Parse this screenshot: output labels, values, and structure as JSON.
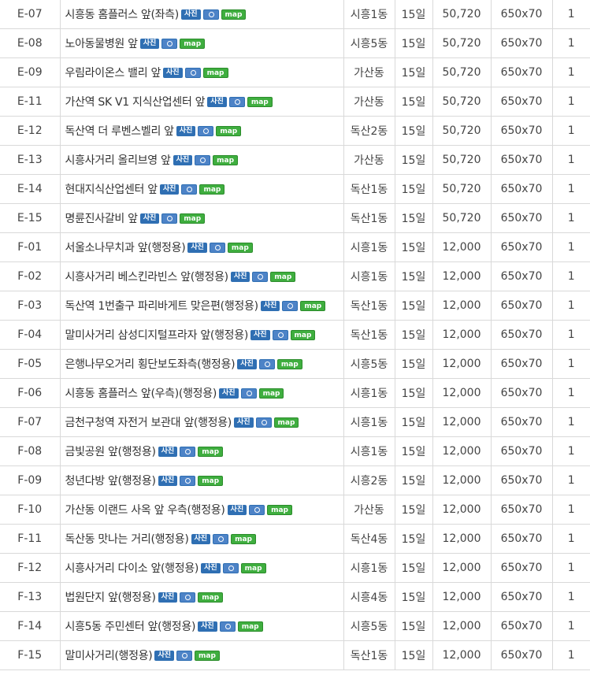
{
  "buttons": {
    "photo": "사진",
    "map": "map"
  },
  "rows": [
    {
      "code": "E-07",
      "name": "시흥동 홈플러스 앞(좌측)",
      "dong": "시흥1동",
      "period": "15일",
      "price": "50,720",
      "size": "650x70",
      "qty": "1"
    },
    {
      "code": "E-08",
      "name": "노아동물병원 앞",
      "dong": "시흥5동",
      "period": "15일",
      "price": "50,720",
      "size": "650x70",
      "qty": "1"
    },
    {
      "code": "E-09",
      "name": "우림라이온스 밸리 앞",
      "dong": "가산동",
      "period": "15일",
      "price": "50,720",
      "size": "650x70",
      "qty": "1"
    },
    {
      "code": "E-11",
      "name": "가산역 SK V1 지식산업센터 앞",
      "dong": "가산동",
      "period": "15일",
      "price": "50,720",
      "size": "650x70",
      "qty": "1"
    },
    {
      "code": "E-12",
      "name": "독산역 더 루벤스벨리 앞",
      "dong": "독산2동",
      "period": "15일",
      "price": "50,720",
      "size": "650x70",
      "qty": "1"
    },
    {
      "code": "E-13",
      "name": "시흥사거리 올리브영 앞",
      "dong": "가산동",
      "period": "15일",
      "price": "50,720",
      "size": "650x70",
      "qty": "1"
    },
    {
      "code": "E-14",
      "name": "현대지식산업센터 앞",
      "dong": "독산1동",
      "period": "15일",
      "price": "50,720",
      "size": "650x70",
      "qty": "1"
    },
    {
      "code": "E-15",
      "name": "명륜진사갈비 앞",
      "dong": "독산1동",
      "period": "15일",
      "price": "50,720",
      "size": "650x70",
      "qty": "1"
    },
    {
      "code": "F-01",
      "name": "서울소나무치과 앞(행정용)",
      "dong": "시흥1동",
      "period": "15일",
      "price": "12,000",
      "size": "650x70",
      "qty": "1"
    },
    {
      "code": "F-02",
      "name": "시흥사거리 베스킨라빈스 앞(행정용)",
      "dong": "시흥1동",
      "period": "15일",
      "price": "12,000",
      "size": "650x70",
      "qty": "1"
    },
    {
      "code": "F-03",
      "name": "독산역 1번출구 파리바게트 맞은편(행정용)",
      "dong": "독산1동",
      "period": "15일",
      "price": "12,000",
      "size": "650x70",
      "qty": "1"
    },
    {
      "code": "F-04",
      "name": "말미사거리 삼성디지털프라자 앞(행정용)",
      "dong": "독산1동",
      "period": "15일",
      "price": "12,000",
      "size": "650x70",
      "qty": "1"
    },
    {
      "code": "F-05",
      "name": "은행나무오거리 횡단보도좌측(행정용)",
      "dong": "시흥5동",
      "period": "15일",
      "price": "12,000",
      "size": "650x70",
      "qty": "1"
    },
    {
      "code": "F-06",
      "name": "시흥동 홈플러스 앞(우측)(행정용)",
      "dong": "시흥1동",
      "period": "15일",
      "price": "12,000",
      "size": "650x70",
      "qty": "1"
    },
    {
      "code": "F-07",
      "name": "금천구청역 자전거 보관대 앞(행정용)",
      "dong": "시흥1동",
      "period": "15일",
      "price": "12,000",
      "size": "650x70",
      "qty": "1"
    },
    {
      "code": "F-08",
      "name": "금빛공원 앞(행정용)",
      "dong": "시흥1동",
      "period": "15일",
      "price": "12,000",
      "size": "650x70",
      "qty": "1"
    },
    {
      "code": "F-09",
      "name": "청년다방 앞(행정용)",
      "dong": "시흥2동",
      "period": "15일",
      "price": "12,000",
      "size": "650x70",
      "qty": "1"
    },
    {
      "code": "F-10",
      "name": "가산동 이랜드 사옥 앞 우측(행정용)",
      "dong": "가산동",
      "period": "15일",
      "price": "12,000",
      "size": "650x70",
      "qty": "1"
    },
    {
      "code": "F-11",
      "name": "독산동 맛나는 거리(행정용)",
      "dong": "독산4동",
      "period": "15일",
      "price": "12,000",
      "size": "650x70",
      "qty": "1"
    },
    {
      "code": "F-12",
      "name": "시흥사거리 다이소 앞(행정용)",
      "dong": "시흥1동",
      "period": "15일",
      "price": "12,000",
      "size": "650x70",
      "qty": "1"
    },
    {
      "code": "F-13",
      "name": "법원단지 앞(행정용)",
      "dong": "시흥4동",
      "period": "15일",
      "price": "12,000",
      "size": "650x70",
      "qty": "1"
    },
    {
      "code": "F-14",
      "name": "시흥5동 주민센터 앞(행정용)",
      "dong": "시흥5동",
      "period": "15일",
      "price": "12,000",
      "size": "650x70",
      "qty": "1"
    },
    {
      "code": "F-15",
      "name": "말미사거리(행정용)",
      "dong": "독산1동",
      "period": "15일",
      "price": "12,000",
      "size": "650x70",
      "qty": "1"
    }
  ]
}
